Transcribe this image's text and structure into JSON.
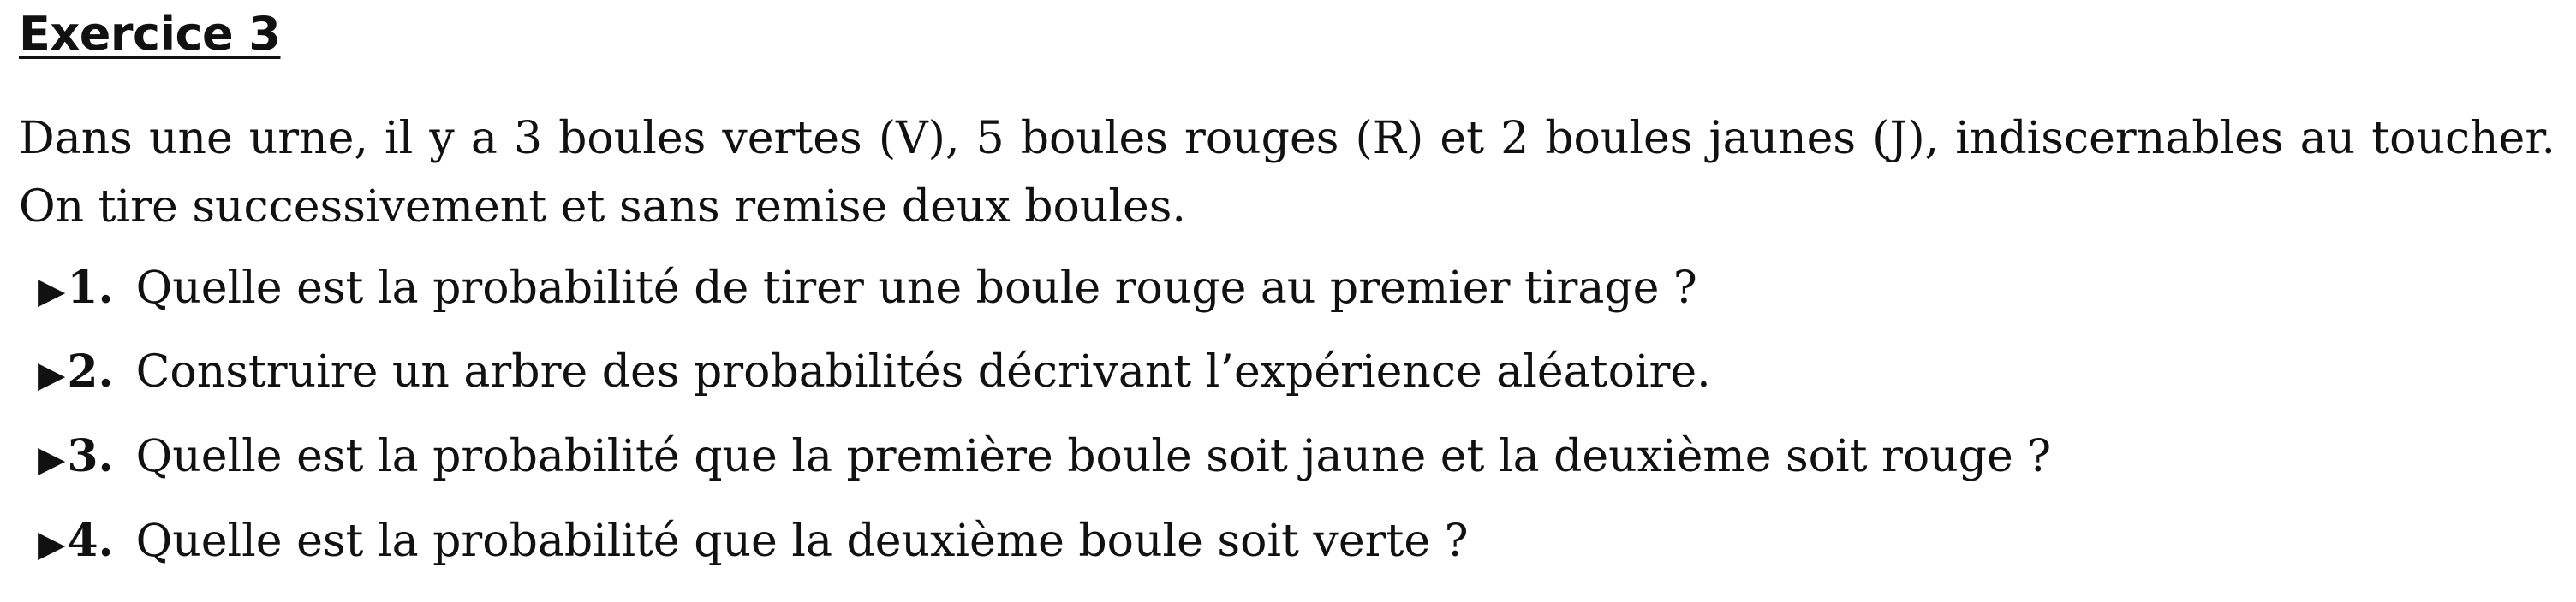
{
  "exercise": {
    "title": "Exercice 3",
    "intro": "Dans une urne, il y a 3 boules vertes (V), 5 boules rouges (R) et 2 boules jaunes (J), indiscernables au toucher. On tire successivement et sans remise deux boules.",
    "marker_glyph": "▶",
    "questions": [
      {
        "number": "1.",
        "text": "Quelle est la probabilité de tirer une boule rouge au premier tirage ?"
      },
      {
        "number": "2.",
        "text": "Construire un arbre des probabilités décrivant l’expérience aléatoire."
      },
      {
        "number": "3.",
        "text": "Quelle est la probabilité que la première boule soit jaune et la deuxième soit rouge ?"
      },
      {
        "number": "4.",
        "text": "Quelle est la probabilité que la deuxième boule soit verte ?"
      }
    ]
  }
}
